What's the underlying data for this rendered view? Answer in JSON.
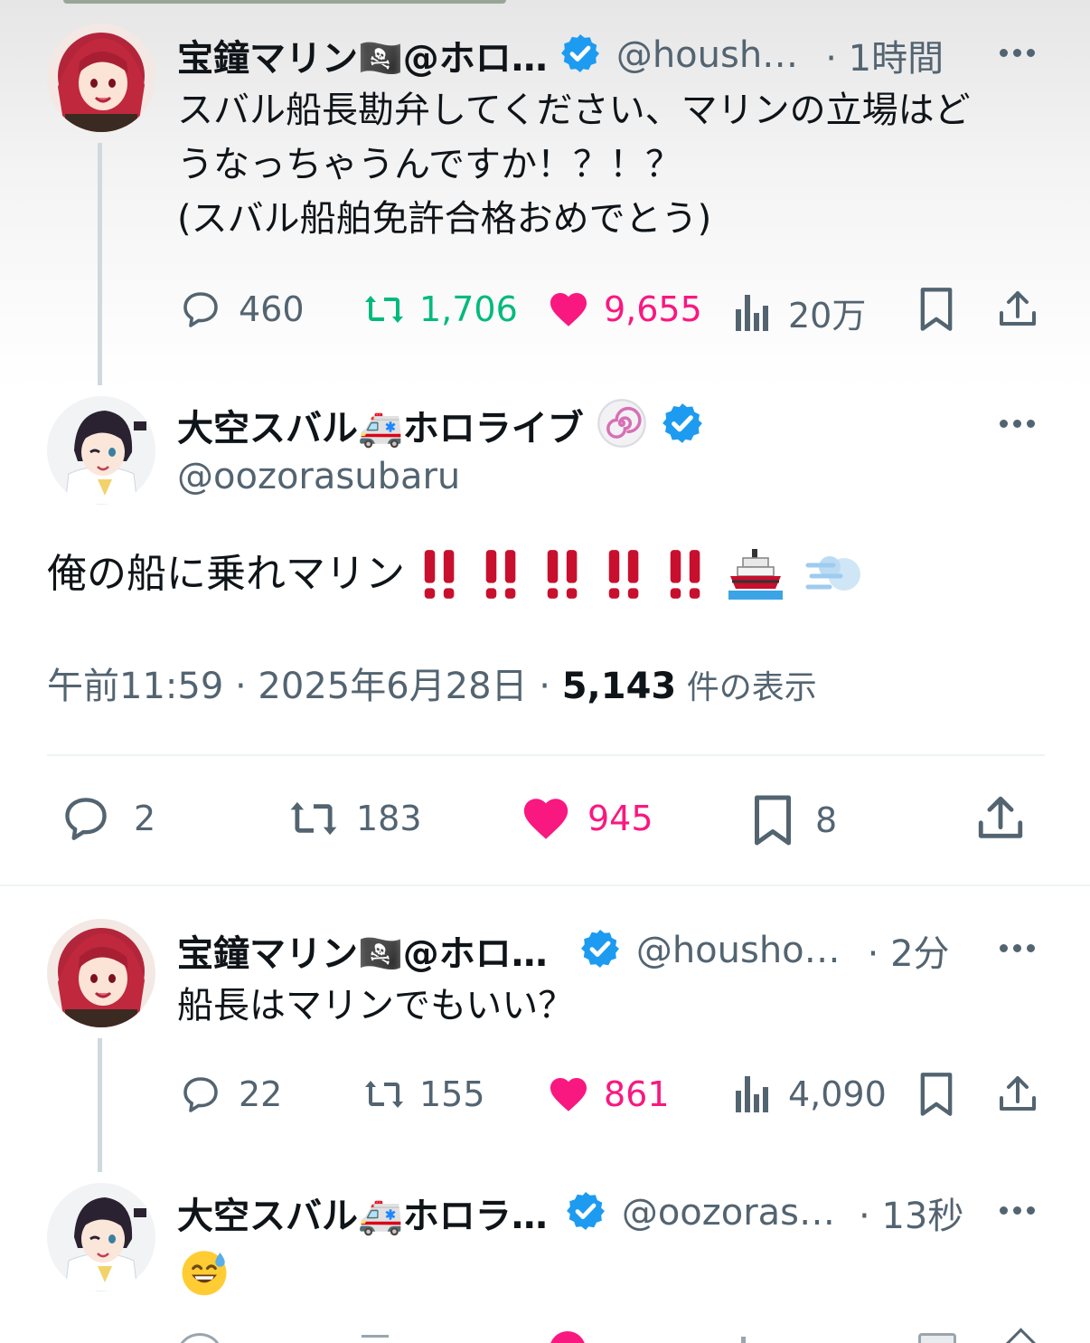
{
  "tweets": {
    "t1": {
      "name": "宝鐘マリン🏴‍☠️@ホロ…",
      "handle": "@housh…",
      "time": "· 1時間",
      "line1": "スバル船長勘弁してください、マリンの立場はど",
      "line2": "うなっちゃうんですか！？！？",
      "line3": "(スバル船舶免許合格おめでとう)",
      "replies": "460",
      "retweets": "1,706",
      "likes": "9,655",
      "views": "20万"
    },
    "main": {
      "name": "大空スバル🚑ホロライブ",
      "handle": "@oozorasubaru",
      "text": "俺の船に乗れマリン",
      "time": "午前11:59 · 2025年6月28日 · ",
      "views_count": "5,143",
      "views_label": " 件の表示",
      "replies": "2",
      "retweets": "183",
      "likes": "945",
      "bookmarks": "8"
    },
    "t3": {
      "name": "宝鐘マリン🏴‍☠️@ホロ…",
      "handle": "@housho…",
      "time": "· 2分",
      "text": "船長はマリンでもいい？",
      "replies": "22",
      "retweets": "155",
      "likes": "861",
      "views": "4,090"
    },
    "t4": {
      "name": "大空スバル🚑ホロラ…",
      "handle": "@oozoras…",
      "time": "· 13秒"
    }
  },
  "colors": {
    "like": "#f91880",
    "retweet_active": "#00ba7c",
    "verified": "#1d9bf0",
    "muted": "#536471",
    "exclaim": "#c8102e"
  }
}
